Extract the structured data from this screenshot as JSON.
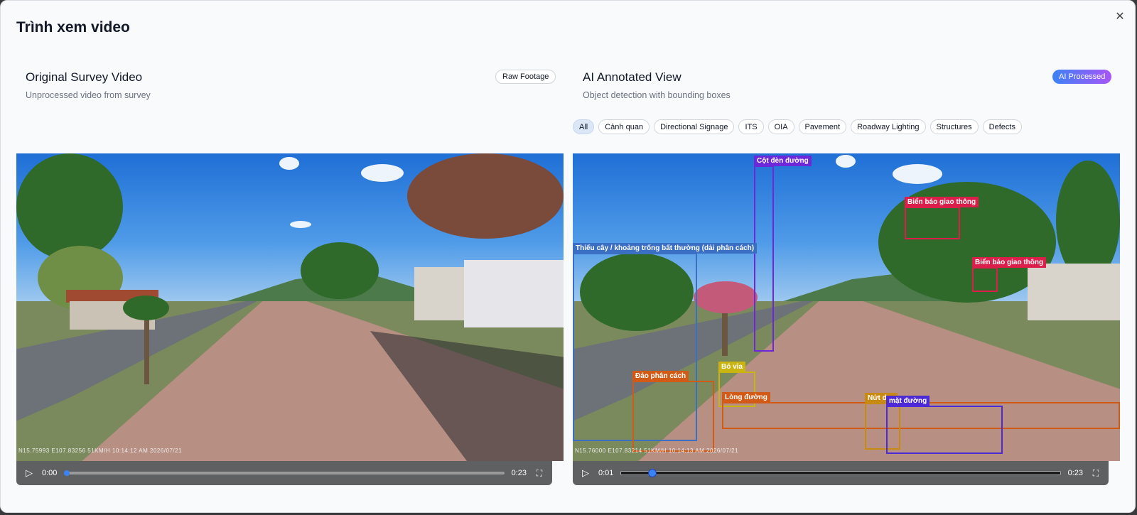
{
  "modal": {
    "title": "Trình xem video",
    "close_icon": "close-icon"
  },
  "left_panel": {
    "title": "Original Survey Video",
    "subtitle": "Unprocessed video from survey",
    "badge": "Raw Footage",
    "overlay": "N15.75993   E107.83256     51KM/H   10:14:12   AM   2026/07/21",
    "player": {
      "current_time": "0:00",
      "duration": "0:23",
      "progress_pct": 0
    }
  },
  "right_panel": {
    "title": "AI Annotated View",
    "subtitle": "Object detection with bounding boxes",
    "badge": "AI Processed",
    "badge_colors": [
      "#3b82f6",
      "#a855f7"
    ],
    "filters": [
      "All",
      "Cảnh quan",
      "Directional Signage",
      "ITS",
      "OIA",
      "Pavement",
      "Roadway Lighting",
      "Structures",
      "Defects"
    ],
    "active_filter": "All",
    "overlay": "N15.76000   E107.83214     51KM/H   10:14:13   AM   2026/07/21",
    "detections": [
      {
        "label": "Cột đèn đường",
        "color": "#6d28d9"
      },
      {
        "label": "Biển báo giao thông",
        "color": "#dc1f4a"
      },
      {
        "label": "Biển báo giao thông",
        "color": "#dc1f4a"
      },
      {
        "label": "Thiếu cây / khoảng trống bất thường (dải phân cách)",
        "color": "#3b6fc4"
      },
      {
        "label": "Đảo phân cách",
        "color": "#d05a16"
      },
      {
        "label": "Bó vỉa",
        "color": "#c9b411"
      },
      {
        "label": "Lòng đường",
        "color": "#d05a16"
      },
      {
        "label": "Nứt dọc",
        "color": "#c98a12"
      },
      {
        "label": "mặt đường",
        "color": "#4c2bd6"
      }
    ],
    "player": {
      "current_time": "0:01",
      "duration": "0:23",
      "progress_pct": 7
    }
  },
  "icons": {
    "play": "play-icon",
    "fullscreen": "fullscreen-icon"
  }
}
